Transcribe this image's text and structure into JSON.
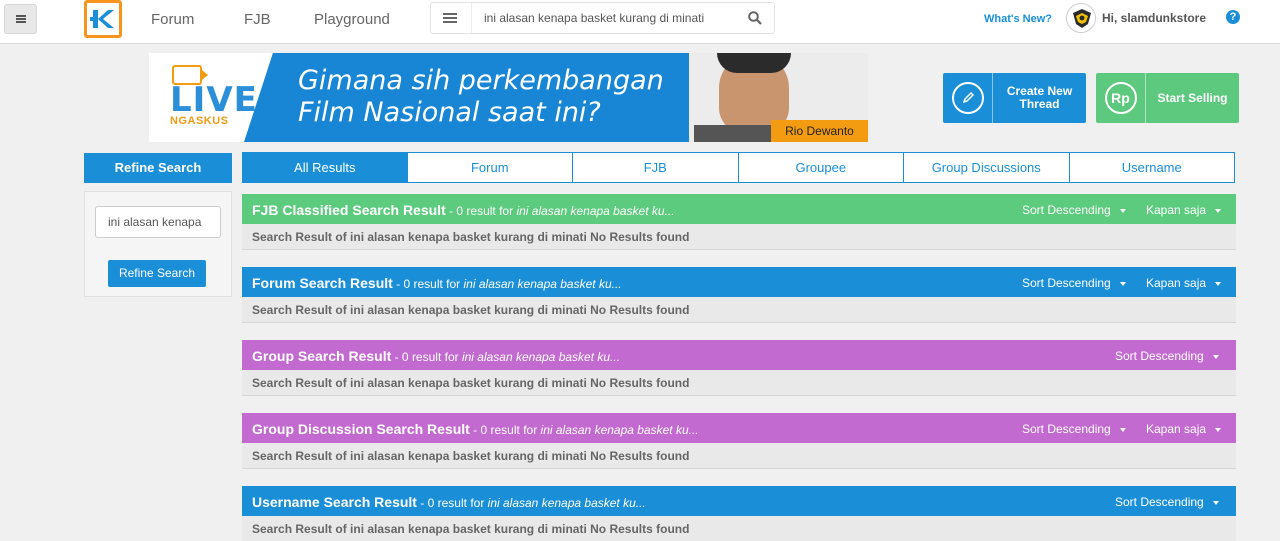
{
  "header": {
    "nav": [
      "Forum",
      "FJB",
      "Playground"
    ],
    "search_value": "ini alasan kenapa basket kurang di minati",
    "whats_new": "What's New?",
    "greeting": "Hi, slamdunkstore",
    "help": "?"
  },
  "banner": {
    "live_word": "LIVE",
    "live_sub": "NGASKUS",
    "headline_line1": "Gimana sih perkembangan",
    "headline_line2": "Film Nasional saat ini?",
    "person_name": "Rio Dewanto"
  },
  "actions": {
    "create_line1": "Create New",
    "create_line2": "Thread",
    "sell_label": "Start Selling",
    "sell_icon_text": "Rp"
  },
  "sidebar": {
    "title": "Refine Search",
    "input_value": "ini alasan kenapa",
    "button_label": "Refine Search"
  },
  "tabs": [
    "All Results",
    "Forum",
    "FJB",
    "Groupee",
    "Group Discussions",
    "Username"
  ],
  "sections": [
    {
      "title": "FJB Classified Search Result",
      "meta_prefix": " - 0 result for ",
      "query": "ini alasan kenapa basket ku...",
      "sort": "Sort Descending",
      "time": "Kapan saja",
      "body": "Search Result of ini alasan kenapa basket kurang di minati No Results found",
      "color": "#5ccb7e"
    },
    {
      "title": "Forum Search Result",
      "meta_prefix": " - 0 result for ",
      "query": "ini alasan kenapa basket ku...",
      "sort": "Sort Descending",
      "time": "Kapan saja",
      "body": "Search Result of ini alasan kenapa basket kurang di minati No Results found",
      "color": "#1a8fd8"
    },
    {
      "title": "Group Search Result",
      "meta_prefix": " - 0 result for ",
      "query": "ini alasan kenapa basket ku...",
      "sort": "Sort Descending",
      "body": "Search Result of ini alasan kenapa basket kurang di minati No Results found",
      "color": "#c36ad1"
    },
    {
      "title": "Group Discussion Search Result",
      "meta_prefix": " - 0 result for ",
      "query": "ini alasan kenapa basket ku...",
      "sort": "Sort Descending",
      "time": "Kapan saja",
      "body": "Search Result of ini alasan kenapa basket kurang di minati No Results found",
      "color": "#c36ad1"
    },
    {
      "title": "Username Search Result",
      "meta_prefix": " - 0 result for ",
      "query": "ini alasan kenapa basket ku...",
      "sort": "Sort Descending",
      "body": "Search Result of ini alasan kenapa basket kurang di minati No Results found",
      "color": "#1a8fd8"
    }
  ]
}
